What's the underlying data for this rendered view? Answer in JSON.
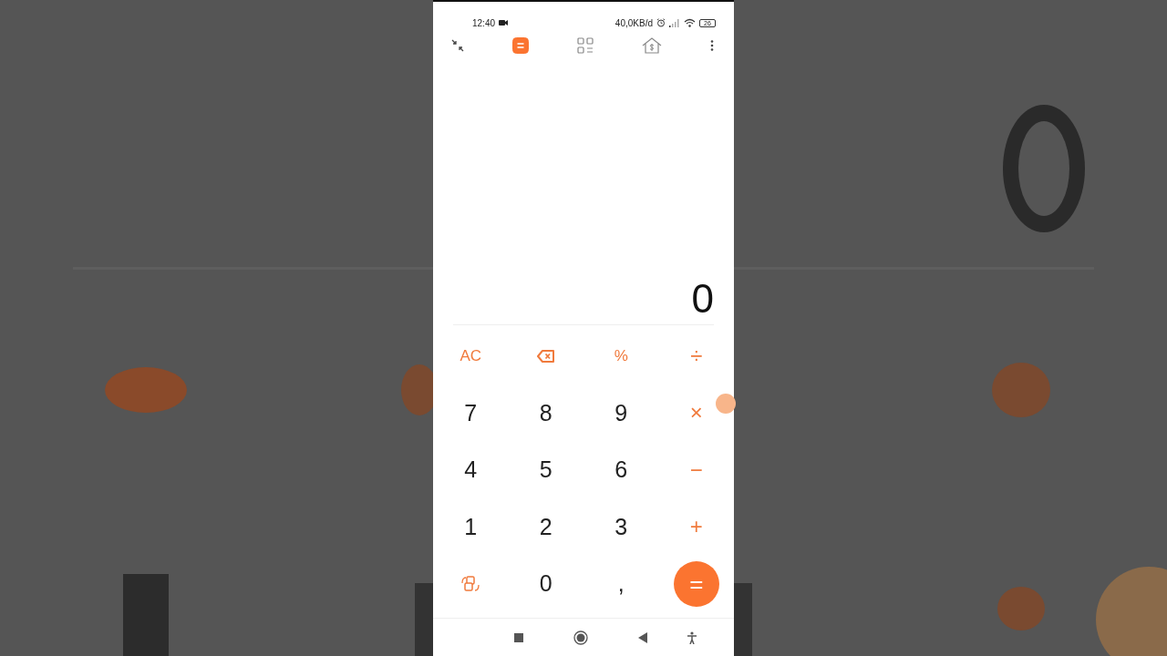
{
  "status_bar": {
    "time": "12:40",
    "speed": "40,0KB/d",
    "battery": "26"
  },
  "toolbar_tabs": [
    {
      "kind": "calculator",
      "selected": true
    },
    {
      "kind": "converter",
      "selected": false
    },
    {
      "kind": "finance",
      "selected": false
    }
  ],
  "display": {
    "result": "0"
  },
  "keys": [
    {
      "kind": "operator",
      "label": "AC"
    },
    {
      "kind": "backspace"
    },
    {
      "kind": "operator",
      "label": "%"
    },
    {
      "kind": "operator",
      "label": "÷"
    },
    {
      "kind": "digit",
      "label": "7"
    },
    {
      "kind": "digit",
      "label": "8"
    },
    {
      "kind": "digit",
      "label": "9"
    },
    {
      "kind": "operator",
      "label": "×"
    },
    {
      "kind": "digit",
      "label": "4"
    },
    {
      "kind": "digit",
      "label": "5"
    },
    {
      "kind": "digit",
      "label": "6"
    },
    {
      "kind": "operator",
      "label": "−"
    },
    {
      "kind": "digit",
      "label": "1"
    },
    {
      "kind": "digit",
      "label": "2"
    },
    {
      "kind": "digit",
      "label": "3"
    },
    {
      "kind": "operator",
      "label": "+"
    },
    {
      "kind": "convert"
    },
    {
      "kind": "digit",
      "label": "0"
    },
    {
      "kind": "digit",
      "label": ","
    },
    {
      "kind": "equals",
      "label": "="
    }
  ]
}
